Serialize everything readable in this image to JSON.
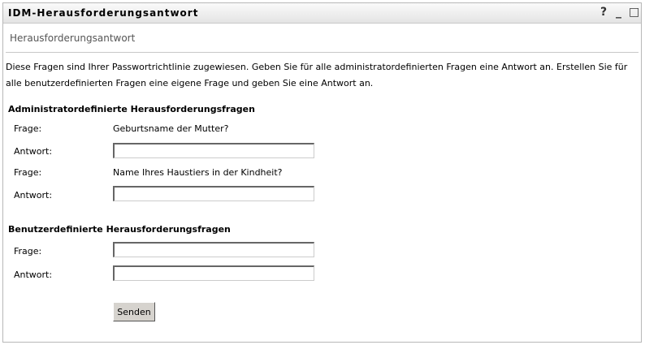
{
  "window": {
    "title": "IDM-Herausforderungsantwort",
    "help": "?",
    "minimize": "_",
    "maximize": "□"
  },
  "subtitle": "Herausforderungsantwort",
  "intro": "Diese Fragen sind Ihrer Passwortrichtlinie zugewiesen. Geben Sie für alle administratordefinierten Fragen eine Antwort an. Erstellen Sie für alle benutzerdefinierten Fragen eine eigene Frage und geben Sie eine Antwort an.",
  "admin": {
    "heading": "Administratordefinierte Herausforderungsfragen",
    "items": [
      {
        "q_label": "Frage:",
        "question": "Geburtsname der Mutter?",
        "a_label": "Antwort:",
        "answer": ""
      },
      {
        "q_label": "Frage:",
        "question": "Name Ihres Haustiers in der Kindheit?",
        "a_label": "Antwort:",
        "answer": ""
      }
    ]
  },
  "user": {
    "heading": "Benutzerdefinierte Herausforderungsfragen",
    "q_label": "Frage:",
    "question": "",
    "a_label": "Antwort:",
    "answer": ""
  },
  "submit": "Senden"
}
